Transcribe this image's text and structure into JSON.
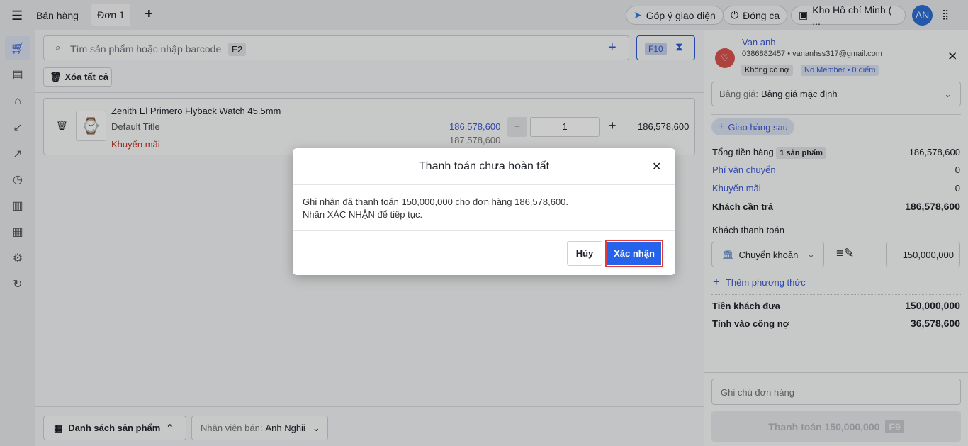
{
  "topbar": {
    "title": "Bán hàng",
    "tab": "Đơn 1",
    "feedback": "Góp ý giao diện",
    "close_shift": "Đóng ca",
    "warehouse": "Kho Hồ chí Minh ( ...",
    "avatar": "AN"
  },
  "search": {
    "placeholder": "Tìm sản phẩm hoặc nhập barcode",
    "shortcut": "F2",
    "f10": "F10"
  },
  "clear_all": "Xóa tất cả",
  "item": {
    "name": "Zenith El Primero Flyback Watch 45.5mm",
    "variant": "Default Title",
    "promo": "Khuyến mãi",
    "price": "186,578,600",
    "old_price": "187,578,600",
    "qty": "1",
    "total": "186,578,600"
  },
  "bottom": {
    "product_list": "Danh sách sản phẩm",
    "staff_label": "Nhân viên bán:",
    "staff": "Anh Nghii"
  },
  "customer": {
    "name": "Van anh",
    "contact": "0386882457 • vananhss317@gmail.com",
    "debt": "Không có nợ",
    "member": "No Member • 0 điểm"
  },
  "pricebook": {
    "label": "Bảng giá:",
    "value": "Bảng giá mặc định"
  },
  "delivery": "Giao hàng sau",
  "summary": {
    "subtotal_label": "Tổng tiền hàng",
    "count": "1 sản phẩm",
    "subtotal": "186,578,600",
    "shipping_label": "Phí vận chuyển",
    "shipping": "0",
    "promo_label": "Khuyến mãi",
    "promo": "0",
    "due_label": "Khách cần trả",
    "due": "186,578,600"
  },
  "payment": {
    "label": "Khách thanh toán",
    "method": "Chuyển khoản",
    "amount": "150,000,000",
    "add_method": "Thêm phương thức",
    "given_label": "Tiền khách đưa",
    "given": "150,000,000",
    "debt_label": "Tính vào công nợ",
    "debt": "36,578,600"
  },
  "note_placeholder": "Ghi chú đơn hàng",
  "pay_button": "Thanh toán 150,000,000",
  "pay_shortcut": "F9",
  "modal": {
    "title": "Thanh toán chưa hoàn tất",
    "line1": "Ghi nhận đã thanh toán 150,000,000 cho đơn hàng 186,578,600.",
    "line2": "Nhấn XÁC NHẬN để tiếp tục.",
    "cancel": "Hủy",
    "confirm": "Xác nhận"
  }
}
